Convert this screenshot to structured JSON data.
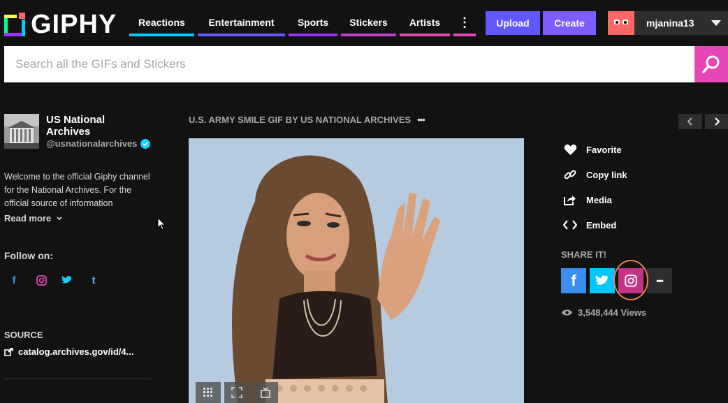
{
  "brand": {
    "logo_text": "GIPHY"
  },
  "nav": {
    "items": [
      {
        "label": "Reactions",
        "color": "#00ccff"
      },
      {
        "label": "Entertainment",
        "color": "#6157ff"
      },
      {
        "label": "Sports",
        "color": "#9933ff"
      },
      {
        "label": "Stickers",
        "color": "#e646b6"
      },
      {
        "label": "Artists",
        "color": "#e646b6"
      }
    ],
    "more_label": "⋮",
    "upload_label": "Upload",
    "create_label": "Create"
  },
  "user": {
    "username": "mjanina13"
  },
  "search": {
    "placeholder": "Search all the GIFs and Stickers"
  },
  "channel": {
    "name": "US National Archives",
    "handle": "@usnationalarchives",
    "description": "Welcome to the official Giphy channel for the National Archives. For the official source of information",
    "read_more": "Read more",
    "follow_label": "Follow on:",
    "source_label": "SOURCE",
    "source_link": "catalog.archives.gov/id/4..."
  },
  "gif": {
    "title": "U.S. ARMY SMILE GIF BY US NATIONAL ARCHIVES",
    "more": "•••"
  },
  "actions": {
    "favorite": "Favorite",
    "copy_link": "Copy link",
    "media": "Media",
    "embed": "Embed"
  },
  "share": {
    "label": "SHARE IT!",
    "views": "3,548,444 Views",
    "more": "•••"
  },
  "colors": {
    "facebook": "#3b8ef0",
    "twitter": "#00c6ff",
    "instagram": "#c13584",
    "highlight_ring": "#e7854b"
  }
}
